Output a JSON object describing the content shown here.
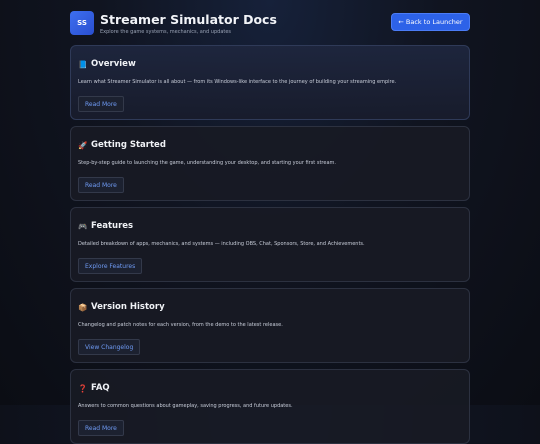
{
  "header": {
    "logo_text": "SS",
    "title": "Streamer Simulator Docs",
    "subtitle": "Explore the game systems, mechanics, and updates",
    "back_label": "← Back to Launcher"
  },
  "colors": {
    "accent": "#2d62e8",
    "link": "#6f9bf5",
    "background": "#0f121a"
  },
  "sections": [
    {
      "icon": "book-icon",
      "glyph": "📘",
      "title": "Overview",
      "desc": "Learn what Streamer Simulator is all about — from its Windows-like interface to the journey of building your streaming empire.",
      "button": "Read More"
    },
    {
      "icon": "rocket-icon",
      "glyph": "🚀",
      "title": "Getting Started",
      "desc": "Step-by-step guide to launching the game, understanding your desktop, and starting your first stream.",
      "button": "Read More"
    },
    {
      "icon": "gamepad-icon",
      "glyph": "🎮",
      "title": "Features",
      "desc": "Detailed breakdown of apps, mechanics, and systems — including OBS, Chat, Sponsors, Store, and Achievements.",
      "button": "Explore Features"
    },
    {
      "icon": "package-icon",
      "glyph": "📦",
      "title": "Version History",
      "desc": "Changelog and patch notes for each version, from the demo to the latest release.",
      "button": "View Changelog"
    },
    {
      "icon": "question-icon",
      "glyph": "❓",
      "title": "FAQ",
      "desc": "Answers to common questions about gameplay, saving progress, and future updates.",
      "button": "Read More"
    }
  ]
}
